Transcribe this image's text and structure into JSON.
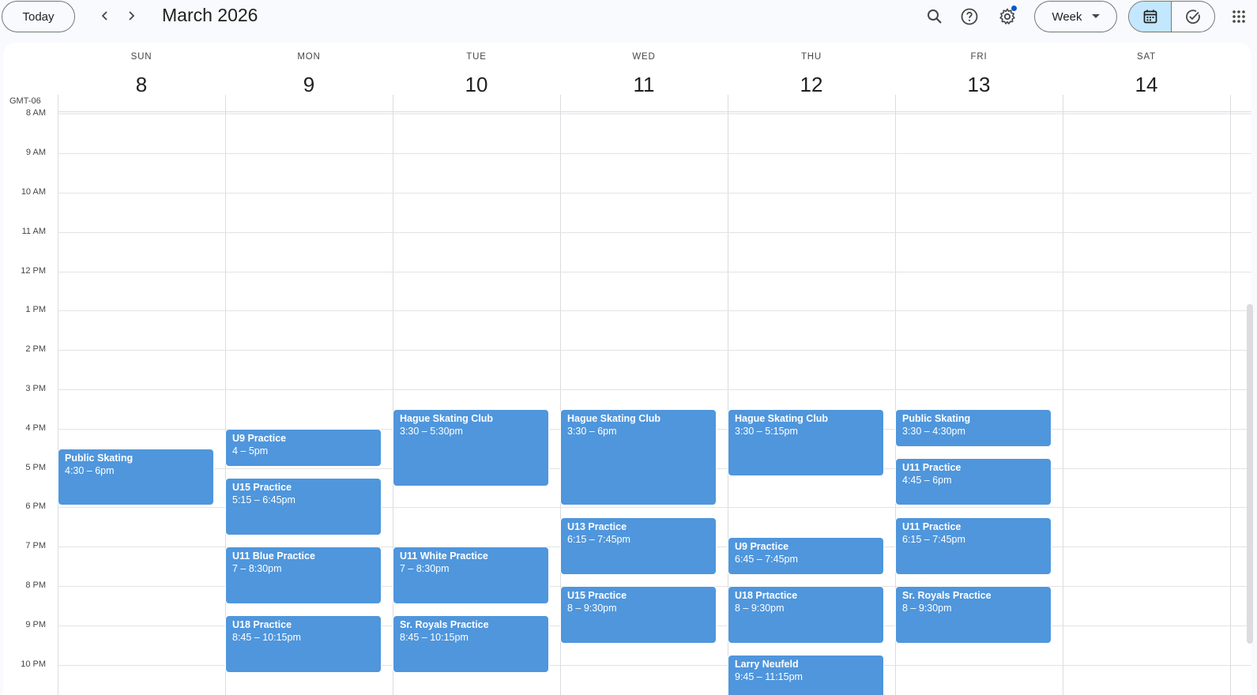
{
  "toolbar": {
    "today_label": "Today",
    "month_title": "March 2026",
    "view_label": "Week"
  },
  "timezone": "GMT-06",
  "days": [
    {
      "name": "SUN",
      "num": "8"
    },
    {
      "name": "MON",
      "num": "9"
    },
    {
      "name": "TUE",
      "num": "10"
    },
    {
      "name": "WED",
      "num": "11"
    },
    {
      "name": "THU",
      "num": "12"
    },
    {
      "name": "FRI",
      "num": "13"
    },
    {
      "name": "SAT",
      "num": "14"
    }
  ],
  "hours": [
    "8 AM",
    "9 AM",
    "10 AM",
    "11 AM",
    "12 PM",
    "1 PM",
    "2 PM",
    "3 PM",
    "4 PM",
    "5 PM",
    "6 PM",
    "7 PM",
    "8 PM",
    "9 PM",
    "10 PM"
  ],
  "events": [
    {
      "day": 0,
      "title": "Public Skating",
      "time": "4:30 – 6pm",
      "start": 16.5,
      "end": 18
    },
    {
      "day": 1,
      "title": "U9 Practice",
      "time": "4 – 5pm",
      "start": 16,
      "end": 17
    },
    {
      "day": 1,
      "title": "U15 Practice",
      "time": "5:15 – 6:45pm",
      "start": 17.25,
      "end": 18.75
    },
    {
      "day": 1,
      "title": "U11 Blue Practice",
      "time": "7 – 8:30pm",
      "start": 19,
      "end": 20.5
    },
    {
      "day": 1,
      "title": "U18 Practice",
      "time": "8:45 – 10:15pm",
      "start": 20.75,
      "end": 22.25
    },
    {
      "day": 2,
      "title": "Hague Skating Club",
      "time": "3:30 – 5:30pm",
      "start": 15.5,
      "end": 17.5
    },
    {
      "day": 2,
      "title": "U11 White Practice",
      "time": "7 – 8:30pm",
      "start": 19,
      "end": 20.5
    },
    {
      "day": 2,
      "title": "Sr. Royals Practice",
      "time": "8:45 – 10:15pm",
      "start": 20.75,
      "end": 22.25
    },
    {
      "day": 3,
      "title": "Hague Skating Club",
      "time": "3:30 – 6pm",
      "start": 15.5,
      "end": 18
    },
    {
      "day": 3,
      "title": "U13 Practice",
      "time": "6:15 – 7:45pm",
      "start": 18.25,
      "end": 19.75
    },
    {
      "day": 3,
      "title": "U15 Practice",
      "time": "8 – 9:30pm",
      "start": 20,
      "end": 21.5
    },
    {
      "day": 4,
      "title": "Hague Skating Club",
      "time": "3:30 – 5:15pm",
      "start": 15.5,
      "end": 17.25
    },
    {
      "day": 4,
      "title": "U9 Practice",
      "time": "6:45 – 7:45pm",
      "start": 18.75,
      "end": 19.75
    },
    {
      "day": 4,
      "title": "U18 Prtactice",
      "time": "8 – 9:30pm",
      "start": 20,
      "end": 21.5
    },
    {
      "day": 4,
      "title": "Larry Neufeld",
      "time": "9:45 – 11:15pm",
      "start": 21.75,
      "end": 23.25
    },
    {
      "day": 5,
      "title": "Public Skating",
      "time": "3:30 – 4:30pm",
      "start": 15.5,
      "end": 16.5
    },
    {
      "day": 5,
      "title": "U11 Practice",
      "time": "4:45 – 6pm",
      "start": 16.75,
      "end": 18
    },
    {
      "day": 5,
      "title": "U11 Practice",
      "time": "6:15 – 7:45pm",
      "start": 18.25,
      "end": 19.75
    },
    {
      "day": 5,
      "title": "Sr. Royals Practice",
      "time": "8 – 9:30pm",
      "start": 20,
      "end": 21.5
    }
  ],
  "colors": {
    "event_bg": "#4f96dc",
    "accent": "#0b57d0",
    "active_toggle": "#c2e7ff"
  },
  "icons": {
    "prev": "chevron-left-icon",
    "next": "chevron-right-icon",
    "search": "search-icon",
    "help": "help-icon",
    "settings": "gear-icon",
    "dropdown": "caret-down-icon",
    "calendar": "calendar-icon",
    "tasks": "task-check-icon",
    "apps": "apps-grid-icon"
  }
}
